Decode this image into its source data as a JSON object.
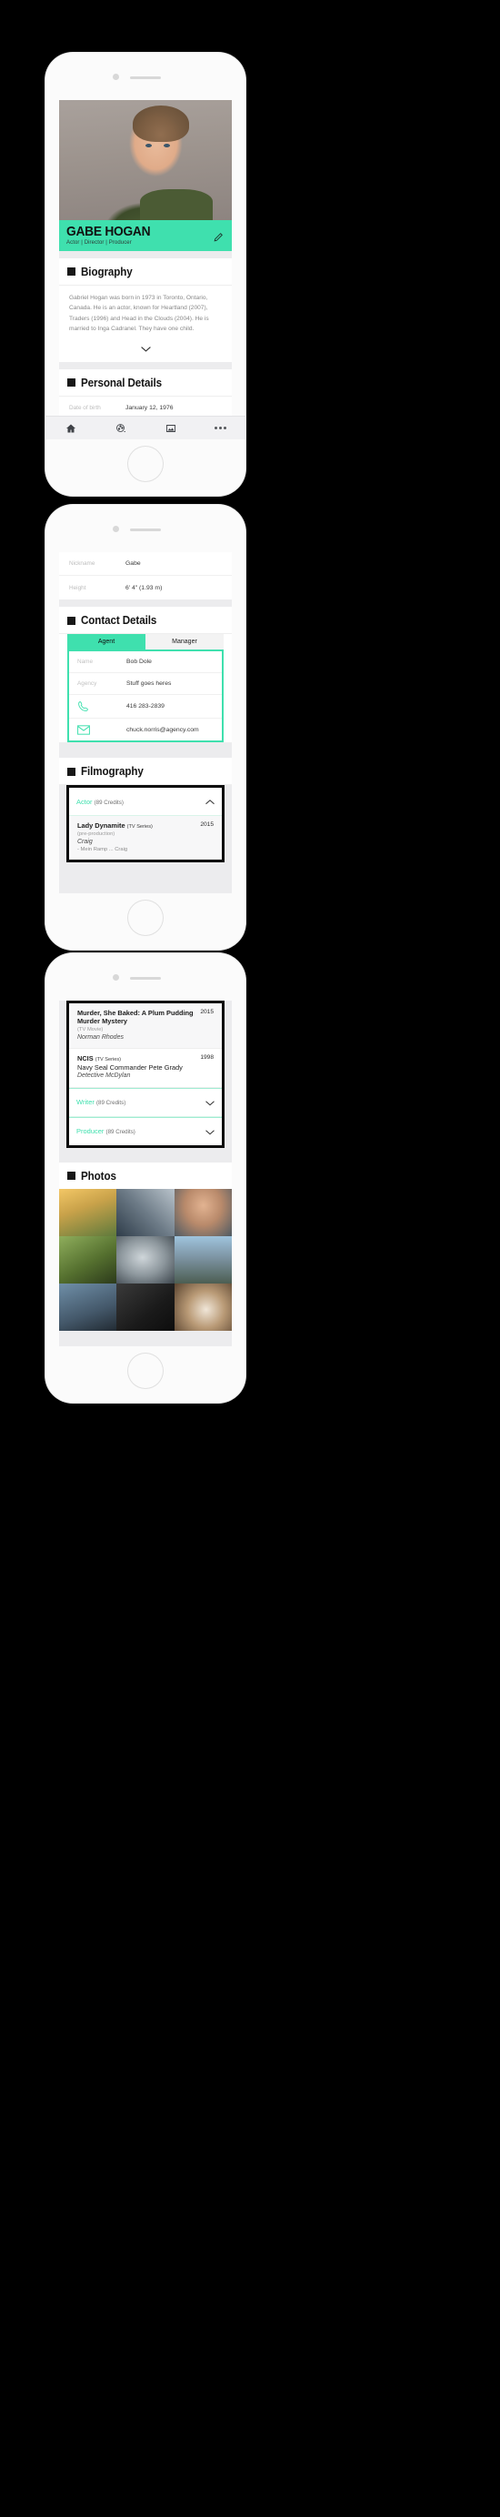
{
  "profile": {
    "name": "GABE HOGAN",
    "roles": "Actor | Director | Producer",
    "edit_icon": "pencil-edit-icon"
  },
  "theme": {
    "accent": "#3fe0ae",
    "text_dark": "#141414",
    "label_grey": "#bdbdbd",
    "screen_bg": "#ececee"
  },
  "biography": {
    "heading": "Biography",
    "text": "Gabriel Hogan was born in 1973 in Toronto, Ontario, Canada. He is an actor, known for Heartland (2007), Traders (1996) and Head in the Clouds (2004). He is married to Inga Cadranel. They have one child.",
    "expand_icon": "chevron-down-icon"
  },
  "personal_details": {
    "heading": "Personal Details",
    "rows": [
      {
        "label": "Date of birth",
        "value": "January 12, 1976"
      },
      {
        "label": "Nickname",
        "value": "Gabe"
      },
      {
        "label": "Height",
        "value": "6' 4\" (1.93 m)"
      }
    ]
  },
  "contact_details": {
    "heading": "Contact Details",
    "tabs": [
      {
        "label": "Agent",
        "active": true
      },
      {
        "label": "Manager",
        "active": false
      }
    ],
    "rows": [
      {
        "label": "Name",
        "value": "Bob Dole",
        "icon": ""
      },
      {
        "label": "Agency",
        "value": "Stuff goes heres",
        "icon": ""
      },
      {
        "label": "",
        "value": "416 283-2839",
        "icon": "phone-icon"
      },
      {
        "label": "",
        "value": "chuck.norris@agency.com",
        "icon": "envelope-icon"
      }
    ]
  },
  "filmography": {
    "heading": "Filmography",
    "accordions": [
      {
        "label": "Actor",
        "count": "(89 Credits)",
        "expanded": true,
        "icon": "chevron-up-icon"
      },
      {
        "label": "Writer",
        "count": "(89 Credits)",
        "expanded": false,
        "icon": "chevron-down-icon"
      },
      {
        "label": "Producer",
        "count": "(89 Credits)",
        "expanded": false,
        "icon": "chevron-down-icon"
      }
    ],
    "credits": [
      {
        "title": "Lady Dynamite",
        "kind": "(TV Series)",
        "year": "2015",
        "status": "(pre-production)",
        "role": "Craig",
        "episode": "- Mein Ramp ... Craig"
      },
      {
        "title": "Murder, She Baked: A Plum Pudding Murder Mystery",
        "kind": "(TV Movie)",
        "year": "2015",
        "status": "",
        "role": "Norman Rhodes",
        "episode": ""
      },
      {
        "title": "NCIS",
        "kind": "(TV Series)",
        "year": "1998",
        "status": "",
        "role": "Navy Seal Commander Pete Grady",
        "episode": "Detective McDylan"
      }
    ]
  },
  "photos": {
    "heading": "Photos",
    "items": [
      {
        "alt": "sunlit-field-photo"
      },
      {
        "alt": "architecture-photo"
      },
      {
        "alt": "portrait-photo"
      },
      {
        "alt": "cyclist-photo"
      },
      {
        "alt": "close-up-face-photo"
      },
      {
        "alt": "mountain-landscape-photo"
      },
      {
        "alt": "road-photo"
      },
      {
        "alt": "dark-photo"
      },
      {
        "alt": "coffee-cup-photo"
      }
    ]
  },
  "tabbar": {
    "items": [
      {
        "icon": "home-icon",
        "name": "tab-home"
      },
      {
        "icon": "film-reel-icon",
        "name": "tab-filmography"
      },
      {
        "icon": "photos-icon",
        "name": "tab-photos"
      },
      {
        "icon": "more-icon",
        "name": "tab-more"
      }
    ]
  }
}
